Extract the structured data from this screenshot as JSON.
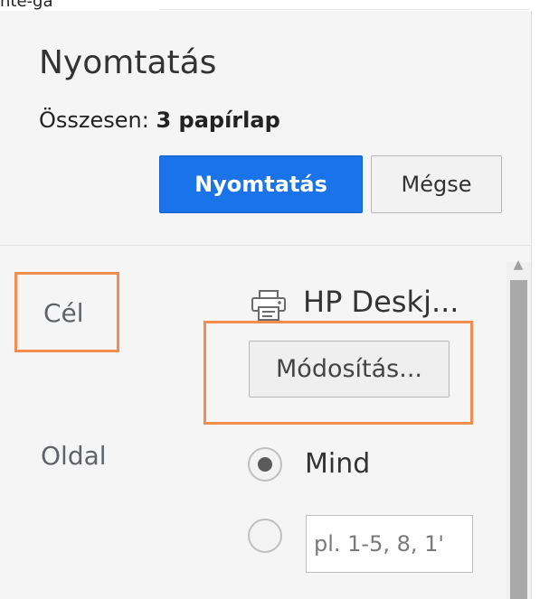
{
  "top": {
    "cut_label": "nte-ga"
  },
  "print_panel": {
    "title": "Nyomtatás",
    "summary_label": "Összesen:",
    "summary_value": "3 papírlap",
    "buttons": {
      "print": "Nyomtatás",
      "cancel": "Mégse"
    },
    "destination": {
      "label": "Cél",
      "printer_name": "HP Deskj...",
      "change_button": "Módosítás...",
      "icon": "printer-icon"
    },
    "pages": {
      "label": "Oldal",
      "all_option": "Mind",
      "custom_placeholder": "pl. 1-5, 8, 1'",
      "selected": "all"
    },
    "colors": {
      "primary_button": "#1a73e8",
      "highlight": "#f28c4f",
      "panel_background": "#f5f5f5"
    }
  }
}
